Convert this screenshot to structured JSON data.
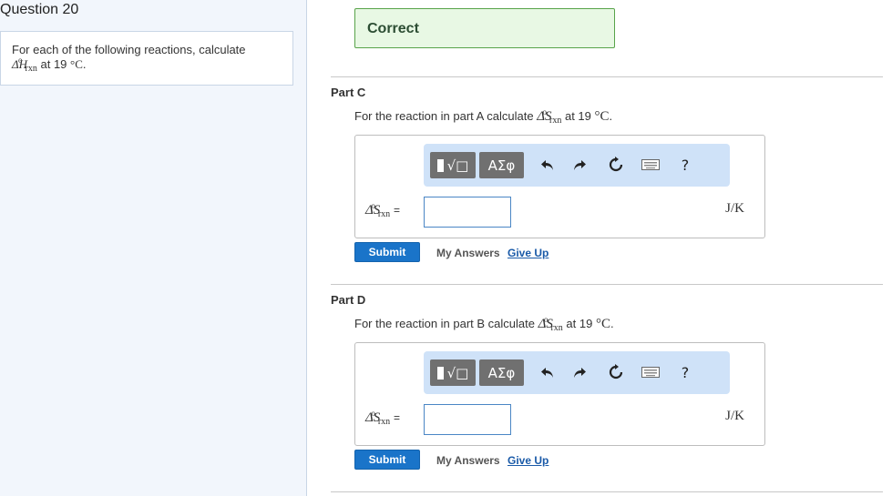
{
  "question": {
    "title": "Question 20",
    "prompt_prefix": "For each of the following reactions, calculate",
    "prompt_symbol": "ΔH",
    "prompt_sub": "rxn",
    "prompt_sup": "o",
    "prompt_suffix": "at 19",
    "prompt_unit": "°C",
    "prompt_end": "."
  },
  "status": {
    "label": "Correct"
  },
  "parts": [
    {
      "label": "Part C",
      "text_prefix": "For the reaction in part A calculate",
      "symbol": "ΔS",
      "sub": "rxn",
      "sup": "o",
      "text_suffix": "at 19",
      "unit_temp": "°C",
      "text_end": ".",
      "var_symbol": "ΔS",
      "var_sub": "rxn",
      "var_sup": "o",
      "equals": "=",
      "input_value": "",
      "unit": "J/K",
      "submit": "Submit",
      "my_answers": "My Answers",
      "give_up": "Give Up"
    },
    {
      "label": "Part D",
      "text_prefix": "For the reaction in part B calculate",
      "symbol": "ΔS",
      "sub": "rxn",
      "sup": "o",
      "text_suffix": "at 19",
      "unit_temp": "°C",
      "text_end": ".",
      "var_symbol": "ΔS",
      "var_sub": "rxn",
      "var_sup": "o",
      "equals": "=",
      "input_value": "",
      "unit": "J/K",
      "submit": "Submit",
      "my_answers": "My Answers",
      "give_up": "Give Up"
    }
  ],
  "toolbar": {
    "template_label": "√□",
    "greek_label": "ΑΣφ",
    "help_label": "?",
    "icons": [
      "templates-icon",
      "greek-symbols-icon",
      "undo-icon",
      "redo-icon",
      "reset-icon",
      "keyboard-icon",
      "help-icon"
    ]
  }
}
